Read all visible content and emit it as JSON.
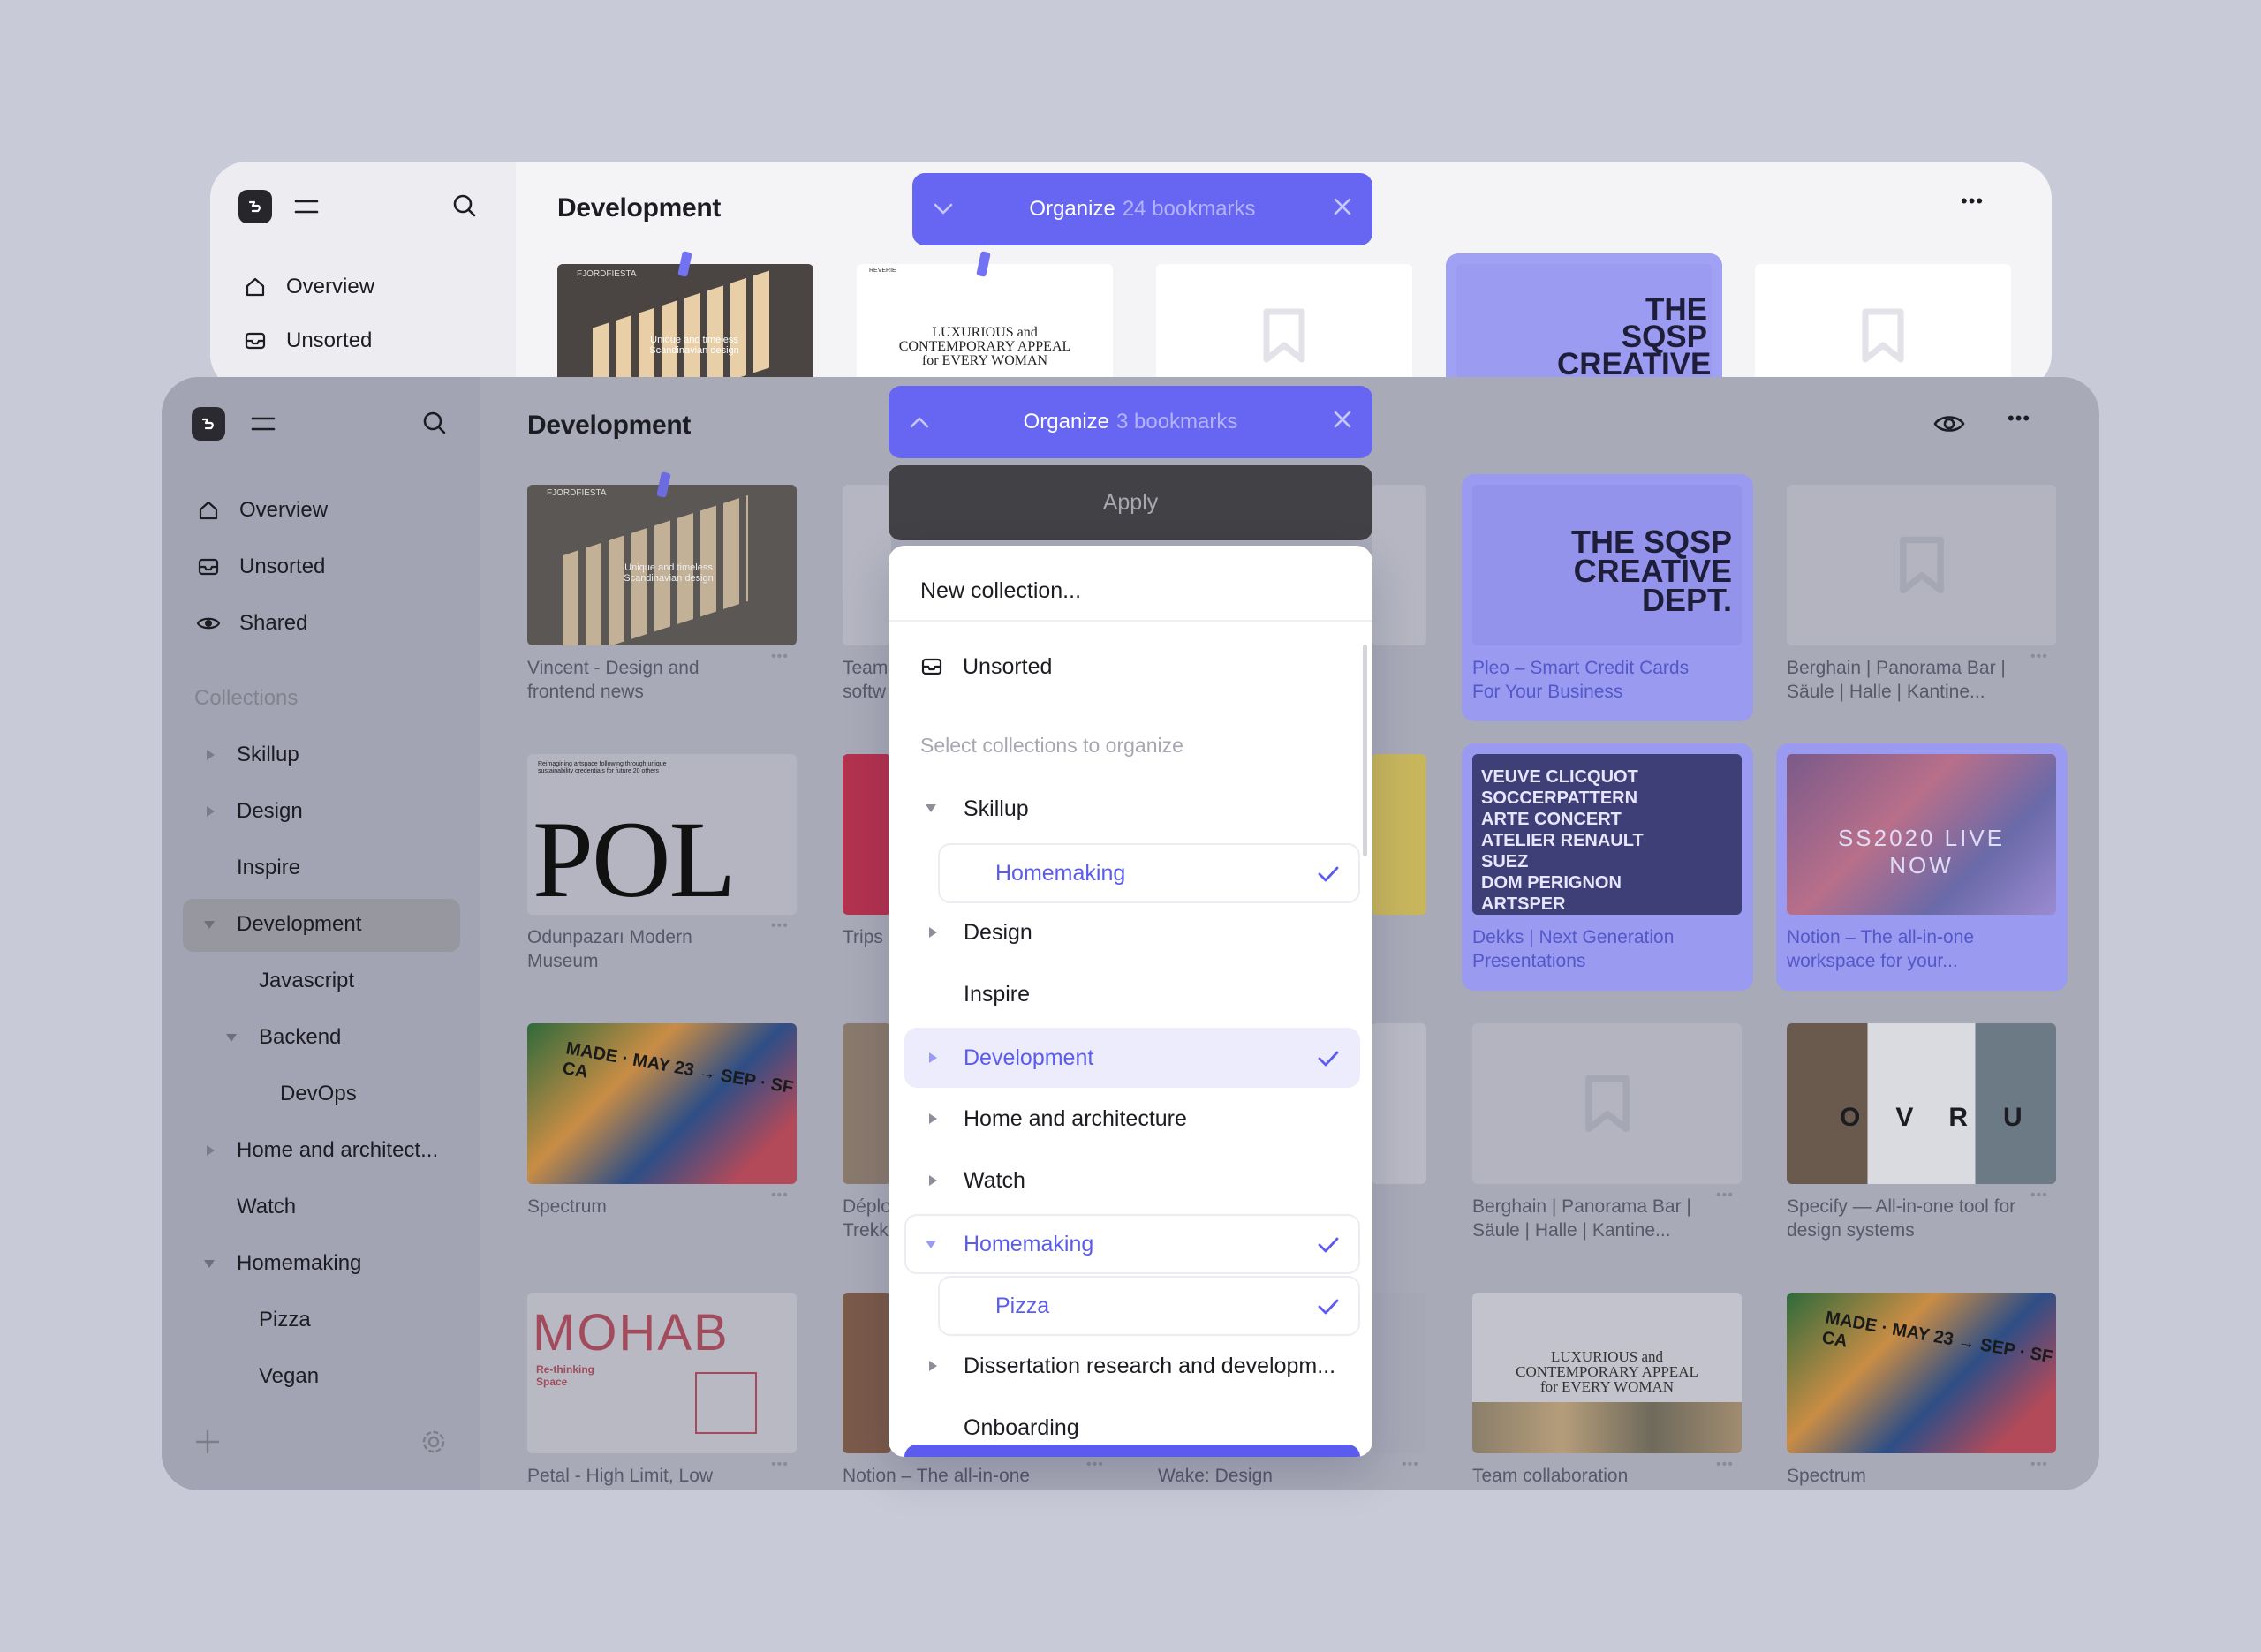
{
  "back_window": {
    "title": "Development",
    "nav": [
      {
        "label": "Overview",
        "icon": "home-icon"
      },
      {
        "label": "Unsorted",
        "icon": "inbox-icon"
      }
    ],
    "organize": {
      "label": "Organize",
      "count": "24 bookmarks"
    },
    "thumbs": [
      {
        "brand": "FJORDFIESTA",
        "overlay": "Unique and timeless Scandinavian design"
      },
      {
        "brand": "REVERIE",
        "text": "LUXURIOUS and CONTEMPORARY APPEAL for EVERY WOMAN"
      },
      {
        "placeholder": true
      },
      {
        "text": "THE SQSP CREATIVE"
      },
      {
        "placeholder": true
      }
    ]
  },
  "front_window": {
    "title": "Development",
    "nav": [
      {
        "label": "Overview",
        "icon": "home-icon"
      },
      {
        "label": "Unsorted",
        "icon": "inbox-icon"
      },
      {
        "label": "Shared",
        "icon": "eye-icon"
      }
    ],
    "collections_heading": "Collections",
    "tree": [
      {
        "label": "Skillup",
        "arrow": "right"
      },
      {
        "label": "Design",
        "arrow": "right"
      },
      {
        "label": "Inspire",
        "arrow": ""
      },
      {
        "label": "Development",
        "arrow": "down",
        "active": true
      },
      {
        "label": "Javascript",
        "arrow": ""
      },
      {
        "label": "Backend",
        "arrow": "down"
      },
      {
        "label": "DevOps",
        "arrow": ""
      },
      {
        "label": "Home and architect...",
        "arrow": "right"
      },
      {
        "label": "Watch",
        "arrow": ""
      },
      {
        "label": "Homemaking",
        "arrow": "down"
      },
      {
        "label": "Pizza",
        "arrow": ""
      },
      {
        "label": "Vegan",
        "arrow": ""
      }
    ],
    "cards": [
      {
        "caption": "Vincent - Design and frontend news",
        "thumb_text": "FJORDFIESTA",
        "thumb_sub": "Unique and timeless Scandinavian design"
      },
      {
        "caption": "Team softw"
      },
      {
        "caption": "Pleo – Smart Credit Cards For Your Business",
        "thumb_text": "THE SQSP CREATIVE DEPT.",
        "selected": true
      },
      {
        "caption": "Berghain | Panorama Bar | Säule | Halle | Kantine..."
      },
      {
        "caption": "Odunpazarı Modern Museum",
        "thumb_text": "POL",
        "thumb_sub": "Reimagining artspace following through unique sustainability credentials for future 20 others"
      },
      {
        "caption": "Trips"
      },
      {
        "caption": "Dekks | Next Generation Presentations",
        "thumb_lines": [
          "VEUVE CLICQUOT",
          "SOCCERPATTERN",
          "ARTE CONCERT",
          "ATELIER RENAULT",
          "SUEZ",
          "DOM PERIGNON",
          "ARTSPER"
        ],
        "selected": true
      },
      {
        "caption": "Notion – The all-in-one workspace for your...",
        "thumb_text": "SS2020 LIVE NOW",
        "selected": true
      },
      {
        "caption": "Spectrum",
        "thumb_text": "MADE · MAY 23 → SEP · SF CA"
      },
      {
        "caption": "Déplo Trekk"
      },
      {
        "caption": "Berghain | Panorama Bar | Säule | Halle | Kantine..."
      },
      {
        "caption": "Specify — All-in-one tool for design systems",
        "thumb_text": "OVRU"
      },
      {
        "caption": "Petal - High Limit, Low",
        "thumb_text": "MOHAB",
        "thumb_sub": "Re-thinking Space"
      },
      {
        "caption": "Notion – The all-in-one"
      },
      {
        "caption": "Wake: Design"
      },
      {
        "caption": "Team collaboration",
        "thumb_text": "LUXURIOUS and CONTEMPORARY APPEAL for EVERY WOMAN"
      },
      {
        "caption": "Spectrum",
        "thumb_text": "MADE · MAY 23 → SEP · SF CA"
      }
    ],
    "organize": {
      "label": "Organize",
      "count": "3 bookmarks"
    },
    "apply_label": "Apply",
    "dropdown": {
      "new_collection": "New collection...",
      "unsorted": "Unsorted",
      "hint": "Select collections to organize",
      "items": [
        {
          "label": "Skillup",
          "arrow": "down",
          "checked": false
        },
        {
          "label": "Homemaking",
          "arrow": "",
          "checked": true,
          "child": true
        },
        {
          "label": "Design",
          "arrow": "right",
          "checked": false
        },
        {
          "label": "Inspire",
          "arrow": "",
          "checked": false
        },
        {
          "label": "Development",
          "arrow": "right",
          "checked": true
        },
        {
          "label": "Home and architecture",
          "arrow": "right",
          "checked": false
        },
        {
          "label": "Watch",
          "arrow": "right",
          "checked": false
        },
        {
          "label": "Homemaking",
          "arrow": "down",
          "checked": true
        },
        {
          "label": "Pizza",
          "arrow": "",
          "checked": true,
          "child": true
        },
        {
          "label": "Dissertation research and developm...",
          "arrow": "right",
          "checked": false
        },
        {
          "label": "Onboarding",
          "arrow": "",
          "checked": false
        }
      ]
    }
  },
  "colors": {
    "background": "#c9cad8",
    "accent": "#6666f3",
    "selected_card": "#9a9af0"
  }
}
